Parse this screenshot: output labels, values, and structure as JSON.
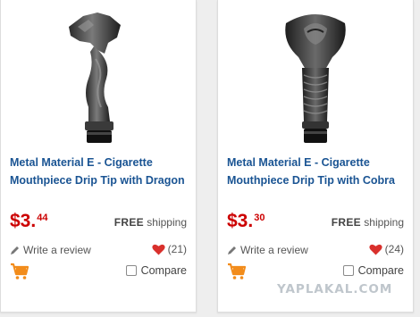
{
  "products": [
    {
      "title": "Metal Material E - Cigarette Mouthpiece Drip Tip with Dragon",
      "image_icon": "dragon-drip-tip-image",
      "price_dollars": "$3.",
      "price_cents": "44",
      "shipping_label": "FREE",
      "shipping_suffix": "shipping",
      "review_label": "Write a review",
      "likes": "(21)",
      "compare_label": "Compare"
    },
    {
      "title": "Metal Material E - Cigarette Mouthpiece Drip Tip with Cobra",
      "image_icon": "cobra-drip-tip-image",
      "price_dollars": "$3.",
      "price_cents": "30",
      "shipping_label": "FREE",
      "shipping_suffix": "shipping",
      "review_label": "Write a review",
      "likes": "(24)",
      "compare_label": "Compare"
    }
  ],
  "watermark": "YAPLAKAL.COM",
  "colors": {
    "title": "#1a5493",
    "price": "#cc0000",
    "heart": "#d9302c",
    "cart": "#f28c1b"
  }
}
